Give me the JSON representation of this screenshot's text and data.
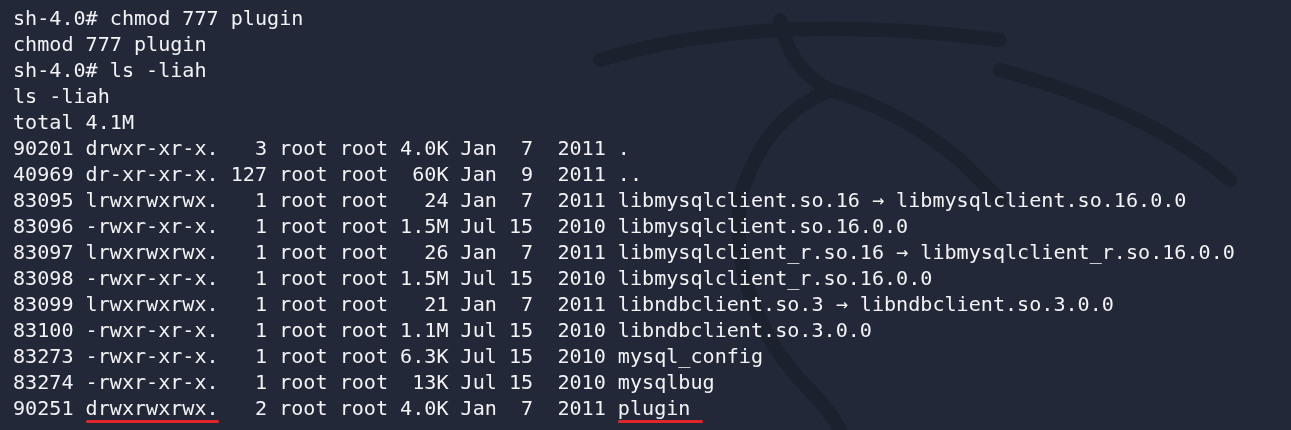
{
  "terminal": {
    "lines": [
      {
        "text": "sh-4.0# chmod 777 plugin"
      },
      {
        "text": "chmod 777 plugin"
      },
      {
        "text": "sh-4.0# ls -liah"
      },
      {
        "text": "ls -liah"
      },
      {
        "text": "total 4.1M"
      },
      {
        "text": "90201 drwxr-xr-x.   3 root root 4.0K Jan  7  2011 ."
      },
      {
        "text": "40969 dr-xr-xr-x. 127 root root  60K Jan  9  2011 .."
      },
      {
        "text": "83095 lrwxrwxrwx.   1 root root   24 Jan  7  2011 libmysqlclient.so.16 → libmysqlclient.so.16.0.0"
      },
      {
        "text": "83096 -rwxr-xr-x.   1 root root 1.5M Jul 15  2010 libmysqlclient.so.16.0.0"
      },
      {
        "text": "83097 lrwxrwxrwx.   1 root root   26 Jan  7  2011 libmysqlclient_r.so.16 → libmysqlclient_r.so.16.0.0"
      },
      {
        "text": "83098 -rwxr-xr-x.   1 root root 1.5M Jul 15  2010 libmysqlclient_r.so.16.0.0"
      },
      {
        "text": "83099 lrwxrwxrwx.   1 root root   21 Jan  7  2011 libndbclient.so.3 → libndbclient.so.3.0.0"
      },
      {
        "text": "83100 -rwxr-xr-x.   1 root root 1.1M Jul 15  2010 libndbclient.so.3.0.0"
      },
      {
        "text": "83273 -rwxr-xr-x.   1 root root 6.3K Jul 15  2010 mysql_config"
      },
      {
        "text": "83274 -rwxr-xr-x.   1 root root  13K Jul 15  2010 mysqlbug"
      },
      {
        "text": "90251 drwxrwxrwx.   2 root root 4.0K Jan  7  2011 plugin",
        "marked": true
      }
    ]
  }
}
